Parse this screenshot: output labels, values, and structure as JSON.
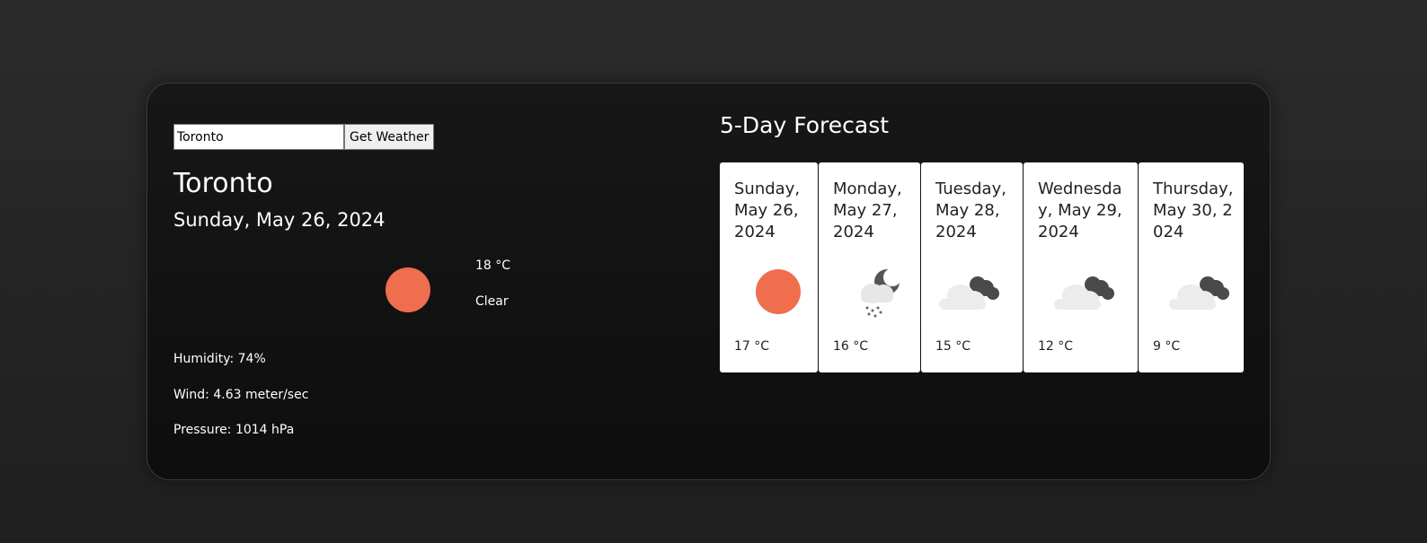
{
  "search": {
    "value": "Toronto",
    "button_label": "Get Weather"
  },
  "current": {
    "city": "Toronto",
    "date": "Sunday, May 26, 2024",
    "icon": "sun-icon",
    "temperature": "18 °C",
    "description": "Clear",
    "humidity": "Humidity: 74%",
    "wind": "Wind: 4.63 meter/sec",
    "pressure": "Pressure: 1014 hPa"
  },
  "forecast": {
    "title": "5-Day Forecast",
    "days": [
      {
        "date": "Sunday, May 26, 2024",
        "icon": "sun-icon",
        "temp": "17 °C"
      },
      {
        "date": "Monday, May 27, 2024",
        "icon": "snow-night-icon",
        "temp": "16 °C"
      },
      {
        "date": "Tuesday, May 28, 2024",
        "icon": "cloudy-night-icon",
        "temp": "15 °C"
      },
      {
        "date": "Wednesday, May 29, 2024",
        "icon": "cloudy-night-icon",
        "temp": "12 °C"
      },
      {
        "date": "Thursday, May 30, 2024",
        "icon": "cloudy-night-icon",
        "temp": "9 °C"
      }
    ]
  },
  "colors": {
    "sun": "#ee6e4e",
    "card_bg": "#121212",
    "page_bg": "#262626",
    "forecast_card_bg": "#ffffff"
  }
}
